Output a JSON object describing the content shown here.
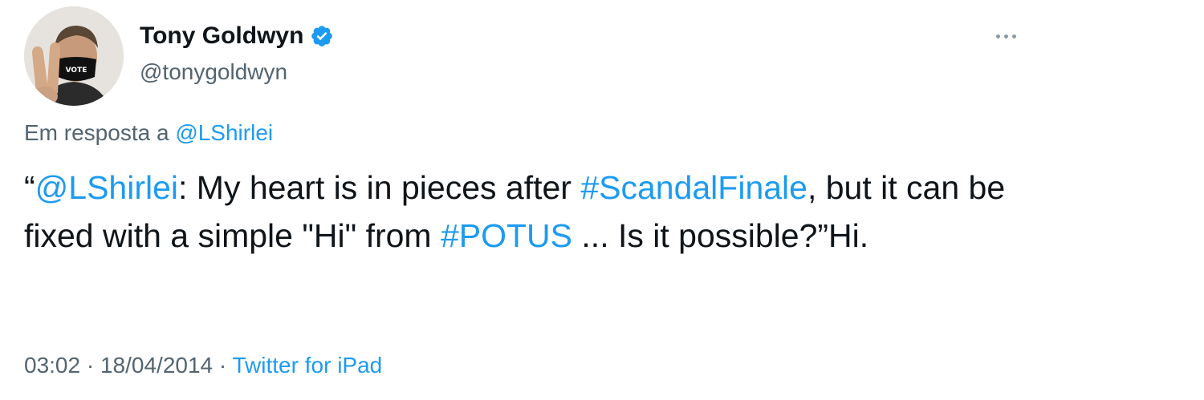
{
  "author": {
    "display_name": "Tony Goldwyn",
    "handle": "@tonygoldwyn",
    "verified": true,
    "mask_text": "VOTE"
  },
  "reply": {
    "prefix": "Em resposta a ",
    "user": "@LShirlei"
  },
  "tweet": {
    "segments": [
      {
        "text": "“",
        "type": "text"
      },
      {
        "text": "@LShirlei",
        "type": "mention"
      },
      {
        "text": ": My heart is in pieces after ",
        "type": "text"
      },
      {
        "text": "#ScandalFinale",
        "type": "hashtag"
      },
      {
        "text": ", but it can be fixed with a simple \"Hi\" from ",
        "type": "text"
      },
      {
        "text": "#POTUS",
        "type": "hashtag"
      },
      {
        "text": " ... Is it possible?”Hi.",
        "type": "text"
      }
    ]
  },
  "meta": {
    "time": "03:02",
    "separator": " · ",
    "date": "18/04/2014",
    "source": "Twitter for iPad"
  },
  "colors": {
    "link": "#1d9bf0",
    "secondary_text": "#536471",
    "primary_text": "#0f1419"
  }
}
